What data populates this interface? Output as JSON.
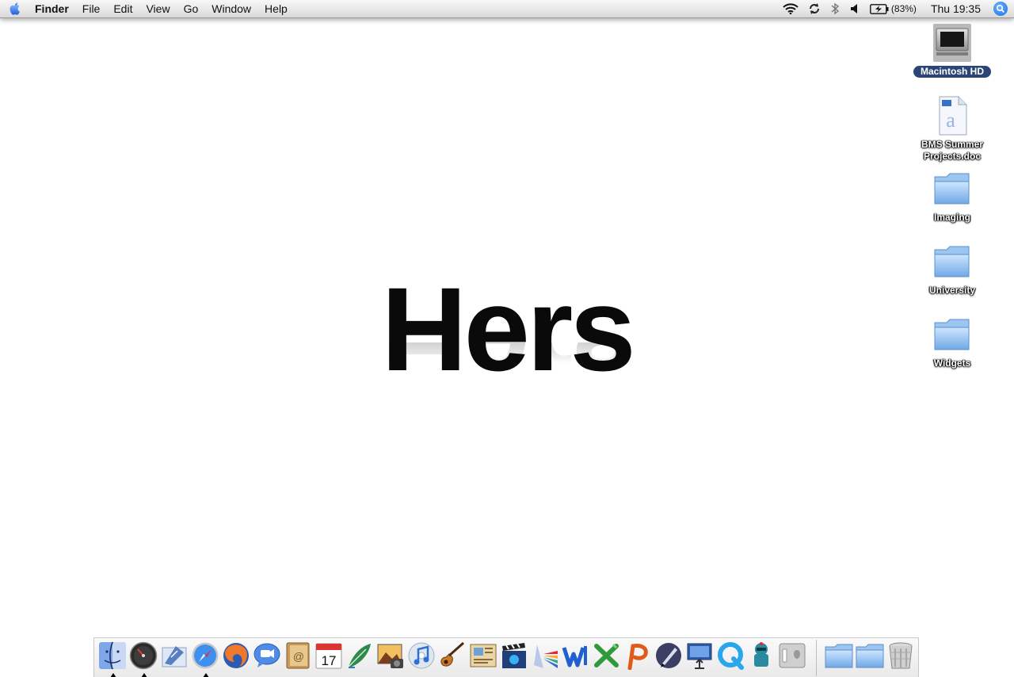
{
  "menubar": {
    "apple_icon": "apple-icon",
    "app_name": "Finder",
    "menus": [
      "File",
      "Edit",
      "View",
      "Go",
      "Window",
      "Help"
    ],
    "battery_percent": "(83%)",
    "clock": "Thu 19:35",
    "status_icons": [
      "wifi-icon",
      "time-machine-sync-icon",
      "bluetooth-icon",
      "volume-icon",
      "battery-charging-icon",
      "spotlight-icon"
    ]
  },
  "center": {
    "text": "Hers"
  },
  "desktop_icons": [
    {
      "label": "Macintosh HD",
      "icon": "hard-drive-icon",
      "selected": true
    },
    {
      "label": "BMS Summer\nProjects.doc",
      "icon": "word-document-icon",
      "selected": false
    },
    {
      "label": "Imaging",
      "icon": "folder-icon",
      "selected": false
    },
    {
      "label": "University",
      "icon": "folder-icon",
      "selected": false
    },
    {
      "label": "Widgets",
      "icon": "folder-icon",
      "selected": false
    }
  ],
  "dock": {
    "apps": [
      {
        "icon": "finder-icon",
        "running": true
      },
      {
        "icon": "dashboard-icon",
        "running": true
      },
      {
        "icon": "mail-icon",
        "running": false
      },
      {
        "icon": "safari-icon",
        "running": true
      },
      {
        "icon": "firefox-icon",
        "running": false
      },
      {
        "icon": "ichat-icon",
        "running": false
      },
      {
        "icon": "address-book-icon",
        "running": false
      },
      {
        "icon": "ical-icon",
        "running": false
      },
      {
        "icon": "feather-icon",
        "running": false
      },
      {
        "icon": "iphoto-icon",
        "running": false
      },
      {
        "icon": "itunes-icon",
        "running": false
      },
      {
        "icon": "garageband-icon",
        "running": false
      },
      {
        "icon": "iweb-icon",
        "running": false
      },
      {
        "icon": "imovie-icon",
        "running": false
      },
      {
        "icon": "aperture-prism-icon",
        "running": false
      },
      {
        "icon": "word-icon",
        "running": false
      },
      {
        "icon": "excel-icon",
        "running": false
      },
      {
        "icon": "powerpoint-icon",
        "running": false
      },
      {
        "icon": "pen-tool-icon",
        "running": false
      },
      {
        "icon": "keynote-icon",
        "running": false
      },
      {
        "icon": "quicktime-icon",
        "running": false
      },
      {
        "icon": "automator-icon",
        "running": false
      },
      {
        "icon": "system-preferences-icon",
        "running": false
      }
    ],
    "stacks": [
      {
        "icon": "documents-folder-icon"
      },
      {
        "icon": "downloads-folder-icon"
      },
      {
        "icon": "trash-icon"
      }
    ],
    "calendar_day": "17"
  },
  "colors": {
    "selection": "#2c4577",
    "folder_blue": "#7fb6ee",
    "spotlight_blue": "#1b6fe0"
  }
}
